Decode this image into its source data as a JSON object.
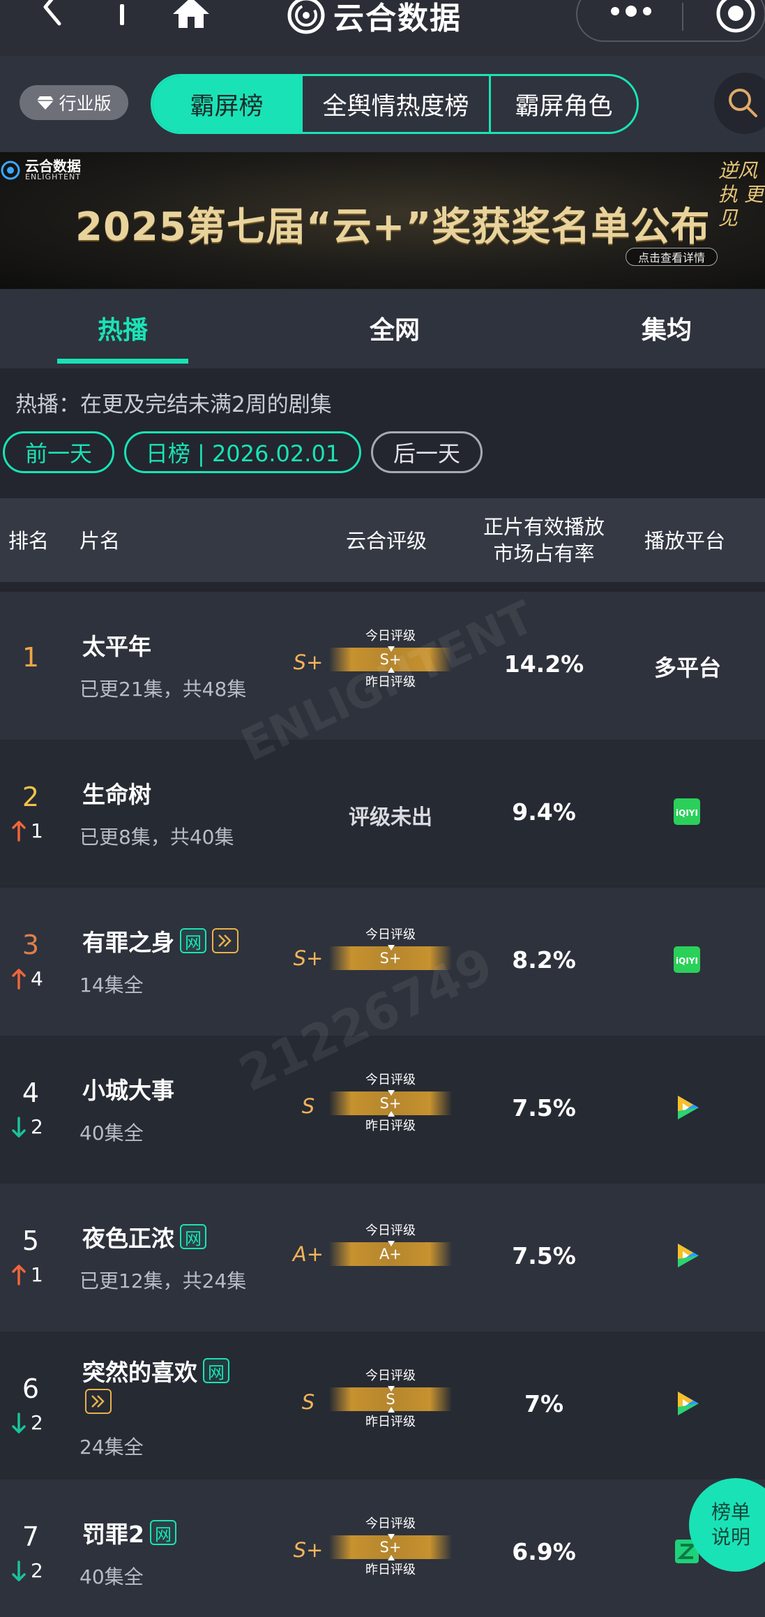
{
  "app": {
    "brand_name": "云合数据"
  },
  "header": {
    "industry_badge": "行业版",
    "tabs": [
      {
        "label": "霸屏榜",
        "active": true
      },
      {
        "label": "全舆情热度榜",
        "active": false
      },
      {
        "label": "霸屏角色",
        "active": false
      }
    ]
  },
  "banner": {
    "logo_cn": "云合数据",
    "logo_en": "ENLIGHTENT",
    "title": "2025第七届“云+”奖获奖名单公布",
    "cta": "点击查看详情",
    "slogan": "逆风执 更见"
  },
  "subtabs": [
    {
      "label": "热播",
      "active": true
    },
    {
      "label": "全网",
      "active": false
    },
    {
      "label": "集均",
      "active": false
    }
  ],
  "description": "热播：在更及完结未满2周的剧集",
  "date_nav": {
    "prev": "前一天",
    "current": "日榜 | 2026.02.01",
    "next": "后一天"
  },
  "table": {
    "headers": {
      "rank": "排名",
      "title": "片名",
      "grade": "云合评级",
      "share_line1": "正片有效播放",
      "share_line2": "市场占有率",
      "platform": "播放平台"
    },
    "today_label": "今日评级",
    "yesterday_label": "昨日评级",
    "rows": [
      {
        "rank": "1",
        "change": "",
        "title": "太平年",
        "episodes": "已更21集，共48集",
        "grade_prev": "S+",
        "grade_today": "S+",
        "share": "14.2%",
        "platform": "多平台"
      },
      {
        "rank": "2",
        "change": "1",
        "change_dir": "up",
        "title": "生命树",
        "episodes": "已更8集，共40集",
        "grade_na": "评级未出",
        "share": "9.4%",
        "platform_icon": "iqiyi-icon"
      },
      {
        "rank": "3",
        "change": "4",
        "change_dir": "up",
        "title": "有罪之身",
        "tag_net": "网",
        "episodes": "14集全",
        "grade_prev": "S+",
        "grade_today": "S+",
        "share": "8.2%",
        "platform_icon": "iqiyi-icon"
      },
      {
        "rank": "4",
        "change": "2",
        "change_dir": "down",
        "title": "小城大事",
        "episodes": "40集全",
        "grade_prev": "S",
        "grade_today": "S+",
        "share": "7.5%",
        "platform_icon": "tencent-video-icon"
      },
      {
        "rank": "5",
        "change": "1",
        "change_dir": "up",
        "title": "夜色正浓",
        "tag_net": "网",
        "episodes": "已更12集，共24集",
        "grade_prev": "A+",
        "grade_today": "A+",
        "share": "7.5%",
        "platform_icon": "tencent-video-icon"
      },
      {
        "rank": "6",
        "change": "2",
        "change_dir": "down",
        "title": "突然的喜欢",
        "tag_net": "网",
        "episodes": "24集全",
        "grade_prev": "S",
        "grade_today": "S",
        "share": "7%",
        "platform_icon": "tencent-video-icon"
      },
      {
        "rank": "7",
        "change": "2",
        "change_dir": "down",
        "title": "罚罪2",
        "tag_net": "网",
        "episodes": "40集全",
        "grade_prev": "S+",
        "grade_today": "S+",
        "share": "6.9%",
        "platform_icon": "youku-icon"
      }
    ]
  },
  "fab": {
    "line1": "榜单",
    "line2": "说明"
  },
  "watermark": {
    "text": "21226749"
  },
  "colors": {
    "accent": "#19e3b6",
    "grade": "#f2b45a",
    "up": "#f0663a",
    "down": "#19c39a"
  }
}
